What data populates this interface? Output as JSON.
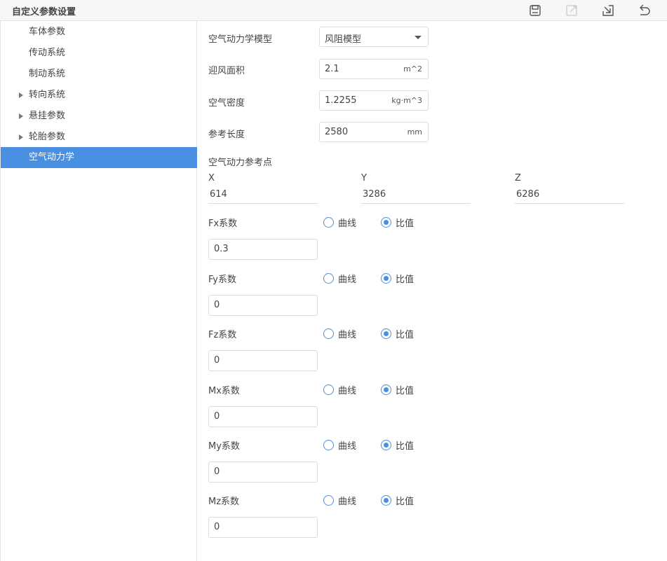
{
  "header": {
    "title": "自定义参数设置"
  },
  "sidebar": {
    "items": [
      {
        "label": "车体参数",
        "expandable": false,
        "active": false
      },
      {
        "label": "传动系统",
        "expandable": false,
        "active": false
      },
      {
        "label": "制动系统",
        "expandable": false,
        "active": false
      },
      {
        "label": "转向系统",
        "expandable": true,
        "active": false
      },
      {
        "label": "悬挂参数",
        "expandable": true,
        "active": false
      },
      {
        "label": "轮胎参数",
        "expandable": true,
        "active": false
      },
      {
        "label": "空气动力学",
        "expandable": false,
        "active": true
      }
    ]
  },
  "form": {
    "model": {
      "label": "空气动力学模型",
      "value": "风阻模型"
    },
    "area": {
      "label": "迎风面积",
      "value": "2.1",
      "unit": "m^2"
    },
    "density": {
      "label": "空气密度",
      "value": "1.2255",
      "unit": "kg·m^3"
    },
    "length": {
      "label": "参考长度",
      "value": "2580",
      "unit": "mm"
    },
    "ref_point": {
      "title": "空气动力参考点",
      "x": {
        "label": "X",
        "value": "614"
      },
      "y": {
        "label": "Y",
        "value": "3286"
      },
      "z": {
        "label": "Z",
        "value": "6286"
      }
    },
    "radio_labels": {
      "curve": "曲线",
      "ratio": "比值"
    },
    "coefficients": [
      {
        "label": "Fx系数",
        "value": "0.3",
        "selected": "ratio"
      },
      {
        "label": "Fy系数",
        "value": "0",
        "selected": "ratio"
      },
      {
        "label": "Fz系数",
        "value": "0",
        "selected": "ratio"
      },
      {
        "label": "Mx系数",
        "value": "0",
        "selected": "ratio"
      },
      {
        "label": "My系数",
        "value": "0",
        "selected": "ratio"
      },
      {
        "label": "Mz系数",
        "value": "0",
        "selected": "ratio"
      }
    ]
  },
  "colors": {
    "accent": "#4a90e2",
    "border": "#dcdcdc",
    "text": "#444444"
  }
}
